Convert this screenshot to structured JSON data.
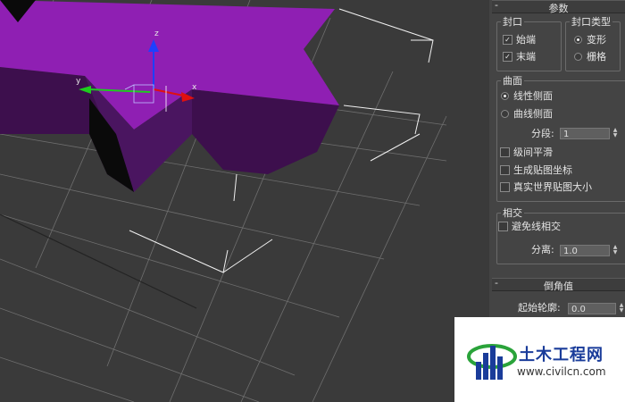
{
  "viewport": {
    "axis_x": "x",
    "axis_y": "y",
    "axis_z": "z",
    "colors": {
      "background": "#3a3a3a",
      "mesh_top": "#8f1fb3",
      "mesh_side": "#3d0f4d",
      "gizmo_z": "#1e3fff",
      "gizmo_y": "#1ecc1e",
      "gizmo_x": "#e01010"
    }
  },
  "panel": {
    "params_rollout": {
      "title": "参数",
      "collapse": "-"
    },
    "cap_group": {
      "label": "封口",
      "start": "始端",
      "end": "末端"
    },
    "cap_type_group": {
      "label": "封口类型",
      "morph": "变形",
      "grid": "栅格"
    },
    "surface_group": {
      "label": "曲面",
      "linear_sides": "线性侧面",
      "curved_sides": "曲线侧面",
      "segments_label": "分段:",
      "segments_value": "1",
      "smooth_across_levels": "级间平滑",
      "generate_mapping": "生成贴图坐标",
      "real_world_map_size": "真实世界贴图大小"
    },
    "intersections_group": {
      "label": "相交",
      "keep_lines": "避免线相交",
      "separation_label": "分离:",
      "separation_value": "1.0"
    },
    "bevel_rollout": {
      "title": "倒角值",
      "collapse": "-"
    },
    "start_outline_label": "起始轮廓:",
    "start_outline_value": "0.0"
  },
  "watermark": {
    "name": "土木工程网",
    "url": "www.civilcn.com"
  }
}
